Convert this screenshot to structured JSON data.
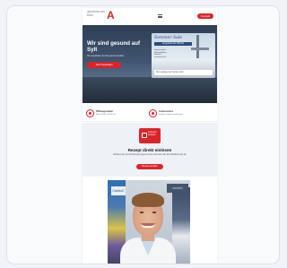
{
  "header": {
    "logo_text": "Apotheke am Dom",
    "logo_mark": "A",
    "menu_icon": "menu-icon",
    "cta_label": "Kontakt"
  },
  "hero": {
    "title": "Wir sind gesund auf Sylt",
    "subtitle": "Ihre Apotheke für die ganze Familie",
    "button_label": "Jetzt bestellen",
    "promo": {
      "title": "Sommer Sale",
      "bar": "Angebote der Woche",
      "items": [
        "Sonnenschutz",
        "Reiseapotheke",
        "Vitamine",
        "Insektenschutz"
      ],
      "footer": "Nur solange der Vorrat reicht"
    }
  },
  "info_strip": {
    "left_title": "Öffnungszeiten",
    "left_text": "Mo–Fr 8:00–18:30 Uhr",
    "right_title": "Lieferservice",
    "right_text": "Direkt zu Ihnen nach Hause"
  },
  "rezept": {
    "badge_text": "E-Rezept einlösen",
    "title": "Rezept direkt einlösen",
    "text": "Schicken Sie uns Ihr Rezept bequem online und holen Sie Ihre Medikamente ab.",
    "button_label": "Rezept senden"
  },
  "photo": {
    "sign_left": "CardioC",
    "sign_right": "eucerin"
  },
  "colors": {
    "accent": "#d9252a",
    "hero": "#3f5470",
    "page_bg": "#f1f3f7"
  }
}
